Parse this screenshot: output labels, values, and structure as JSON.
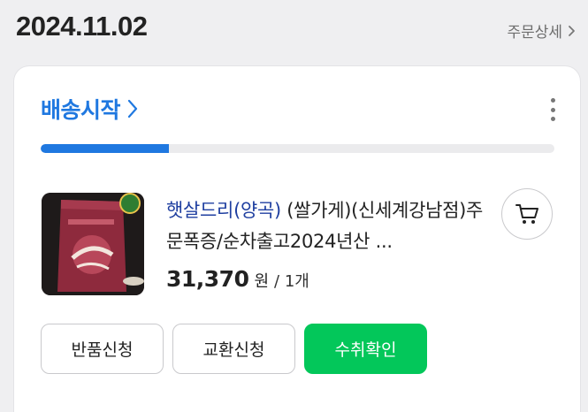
{
  "order": {
    "date": "2024.11.02",
    "detail_link": "주문상세"
  },
  "status": {
    "label": "배송시작",
    "progress": 0.25,
    "accent_color": "#1f78e0"
  },
  "product": {
    "brand": "햇살드리(양곡)",
    "name_rest": " (쌀가게)(신세계강남점)주문폭증/순차출고2024년산 ...",
    "price": "31,370",
    "currency": "원",
    "quantity": "/ 1개",
    "thumbnail_icon": "rice-bag-image"
  },
  "actions": {
    "return_label": "반품신청",
    "exchange_label": "교환신청",
    "confirm_label": "수취확인",
    "confirm_color": "#03c75a"
  },
  "icons": {
    "cart": "cart-icon",
    "more": "more-vertical-icon",
    "chevron": "chevron-right-icon"
  }
}
